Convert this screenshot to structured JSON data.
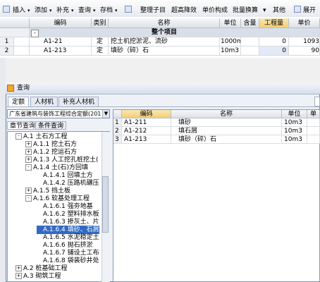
{
  "toolbar": {
    "items": [
      "插入",
      "添加",
      "补充",
      "查询",
      "存档",
      "整理子目",
      "超高降效",
      "单价构成",
      "批量换算",
      "其他",
      "展开"
    ]
  },
  "main_grid": {
    "headers": [
      "编码",
      "类别",
      "名称",
      "单位",
      "含量",
      "工程量",
      "单价"
    ],
    "group_label": "整个项目",
    "group_marker": "-",
    "rows": [
      {
        "num": "1",
        "code": "A1-21",
        "type": "定",
        "name": "挖土机挖淤泥、流砂",
        "unit": "1000m3",
        "qty": "0",
        "price": "1093"
      },
      {
        "num": "2",
        "code": "A1-213",
        "type": "定",
        "name": "填砂（碎）石",
        "unit": "10m3",
        "qty": "0",
        "price": "90"
      }
    ]
  },
  "dialog": {
    "title": "查询",
    "tabs": [
      "定额",
      "人材机",
      "补充人材机"
    ],
    "quota_lib": "广东省建筑与装饰工程综合定额(201",
    "subtabs": [
      "章节查询",
      "条件查询"
    ],
    "tree": [
      {
        "level": 1,
        "exp": "-",
        "label": "A.1 土石方工程"
      },
      {
        "level": 2,
        "exp": "+",
        "label": "A.1.1 挖土石方"
      },
      {
        "level": 2,
        "exp": "+",
        "label": "A.1.2 挖运石方"
      },
      {
        "level": 2,
        "exp": "+",
        "label": "A.1.3 人工挖孔桩挖土("
      },
      {
        "level": 2,
        "exp": "-",
        "label": "A.1.4 土(石)方回填"
      },
      {
        "level": 3,
        "exp": "",
        "label": "A.1.4.1 回填土方"
      },
      {
        "level": 3,
        "exp": "",
        "label": "A.1.4.2 压路机碾压"
      },
      {
        "level": 2,
        "exp": "+",
        "label": "A.1.5 挡土板"
      },
      {
        "level": 2,
        "exp": "-",
        "label": "A.1.6 软基处理工程"
      },
      {
        "level": 3,
        "exp": "",
        "label": "A.1.6.1 强夯地基"
      },
      {
        "level": 3,
        "exp": "",
        "label": "A.1.6.2 塑料排水板"
      },
      {
        "level": 3,
        "exp": "",
        "label": "A.1.6.3 掺灰土、片"
      },
      {
        "level": 3,
        "exp": "",
        "label": "A.1.6.4 填砂、石屑",
        "selected": true
      },
      {
        "level": 3,
        "exp": "",
        "label": "A.1.6.5 水泥稳定土"
      },
      {
        "level": 3,
        "exp": "",
        "label": "A.1.6.6 抛石挤淤"
      },
      {
        "level": 3,
        "exp": "",
        "label": "A.1.6.7 铺设土工布"
      },
      {
        "level": 3,
        "exp": "",
        "label": "A.1.6.8 袋装砂井处"
      },
      {
        "level": 1,
        "exp": "+",
        "label": "A.2 桩基础工程"
      },
      {
        "level": 1,
        "exp": "+",
        "label": "A.3 砌筑工程"
      }
    ],
    "result_headers": [
      "编码",
      "名称",
      "单位",
      "单"
    ],
    "results": [
      {
        "num": "1",
        "code": "A1-211",
        "name": "填砂",
        "unit": "10m3"
      },
      {
        "num": "2",
        "code": "A1-212",
        "name": "填石屑",
        "unit": "10m3"
      },
      {
        "num": "3",
        "code": "A1-213",
        "name": "填砂（碎）石",
        "unit": "10m3"
      }
    ]
  }
}
